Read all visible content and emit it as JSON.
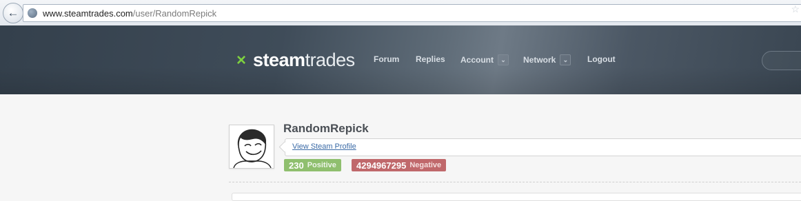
{
  "browser": {
    "url_domain": "www.steamtrades.com",
    "url_path": "/user/RandomRepick"
  },
  "site": {
    "logo_steam": "steam",
    "logo_trades": "trades",
    "nav": {
      "forum": "Forum",
      "replies": "Replies",
      "account": "Account",
      "network": "Network",
      "logout": "Logout"
    }
  },
  "profile": {
    "username": "RandomRepick",
    "steam_link": "View Steam Profile",
    "positive_count": "230",
    "positive_label": "Positive",
    "negative_count": "4294967295",
    "negative_label": "Negative"
  },
  "colors": {
    "logo_accent": "#7ed23f",
    "positive_badge": "#8fbf6e",
    "negative_badge": "#c0686b",
    "link": "#3a6aa6"
  }
}
